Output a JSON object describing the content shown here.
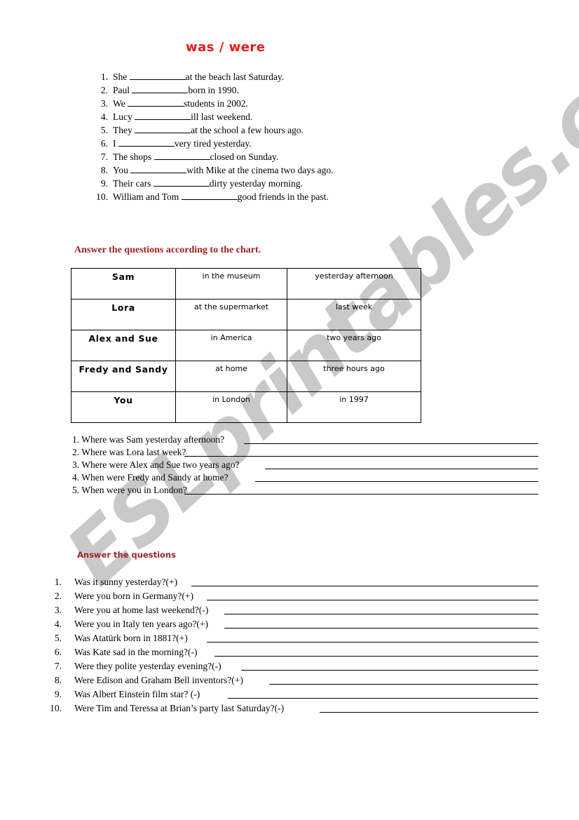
{
  "title": "was / were",
  "watermark": {
    "text": "ESLprintables.com",
    "color": "#c9c9c9"
  },
  "colors": {
    "title_red": "#e51a19",
    "heading_red": "#9e2122",
    "text_black": "#000000"
  },
  "gapfill": {
    "items": [
      {
        "num": "1.",
        "before": "She",
        "after": "at the beach last Saturday.",
        "blank_width": 80
      },
      {
        "num": "2.",
        "before": "Paul",
        "after": "born in 1990.",
        "blank_width": 80
      },
      {
        "num": "3.",
        "before": "We",
        "after": "students in 2002.",
        "blank_width": 80
      },
      {
        "num": "4.",
        "before": "Lucy",
        "after": "ill last weekend.",
        "blank_width": 80
      },
      {
        "num": "5.",
        "before": "They",
        "after": "at the school a few hours ago.",
        "blank_width": 80
      },
      {
        "num": "6.",
        "before": "I",
        "after": "very tired yesterday.",
        "blank_width": 80
      },
      {
        "num": "7.",
        "before": "The shops",
        "after": "closed on Sunday.",
        "blank_width": 80
      },
      {
        "num": "8.",
        "before": "You",
        "after": "with Mike at the cinema two days ago.",
        "blank_width": 80
      },
      {
        "num": "9.",
        "before": "Their cars",
        "after": "dirty yesterday morning.",
        "blank_width": 80
      },
      {
        "num": "10.",
        "before": "William and Tom",
        "after": "good friends in the past.",
        "blank_width": 80
      }
    ]
  },
  "chart_heading": "Answer the questions according to the chart.",
  "chart_data": {
    "type": "table",
    "title": "Answer the questions according to the chart.",
    "columns": [
      "who",
      "place",
      "time"
    ],
    "rows": [
      {
        "who": "Sam",
        "place": "in the museum",
        "time": "yesterday afternoon"
      },
      {
        "who": "Lora",
        "place": "at the supermarket",
        "time": "last week"
      },
      {
        "who": "Alex and Sue",
        "place": "in America",
        "time": "two years ago"
      },
      {
        "who": "Fredy and Sandy",
        "place": "at home",
        "time": "three hours ago"
      },
      {
        "who": "You",
        "place": "in London",
        "time": "in 1997"
      }
    ]
  },
  "chart_questions": {
    "items": [
      {
        "num": "1.",
        "text": "Where was  Sam yesterday afternoon?",
        "rule_width": 420
      },
      {
        "num": "2.",
        "text": "Where was Lora last week?",
        "rule_width": 505
      },
      {
        "num": "3.",
        "text": "Where were Alex and Sue two years ago?",
        "rule_width": 390
      },
      {
        "num": "4.",
        "text": "When were Fredy and Sandy at home?",
        "rule_width": 404
      },
      {
        "num": "5.",
        "text": "When were you in London?",
        "rule_width": 505
      }
    ]
  },
  "answer_heading": "Answer the questions",
  "answer_questions": {
    "items": [
      {
        "num": "1.",
        "text": "Was it sunny yesterday?(+)",
        "rule_width": 495
      },
      {
        "num": "2.",
        "text": "Were you born in Germany?(+)",
        "rule_width": 473
      },
      {
        "num": "3.",
        "text": "Were you at home last weekend?(-)",
        "rule_width": 448
      },
      {
        "num": "4.",
        "text": "Were you in Italy ten years ago?(+)",
        "rule_width": 448
      },
      {
        "num": "5.",
        "text": "Was Atatürk born in 1881?(+)",
        "rule_width": 473
      },
      {
        "num": "6.",
        "text": "Was Kate sad in the morning?(-)",
        "rule_width": 462
      },
      {
        "num": "7.",
        "text": "Were they polite yesterday evening?(-)",
        "rule_width": 424
      },
      {
        "num": "8.",
        "text": "Were Edison and Graham Bell inventors?(+)",
        "rule_width": 384
      },
      {
        "num": "9.",
        "text": "Was Albert Einstein film star? (-)",
        "rule_width": 443
      },
      {
        "num": "10.",
        "text": "Were Tim and Teressa at Brian’s party last Saturday?(-)",
        "rule_width": 312
      }
    ]
  }
}
